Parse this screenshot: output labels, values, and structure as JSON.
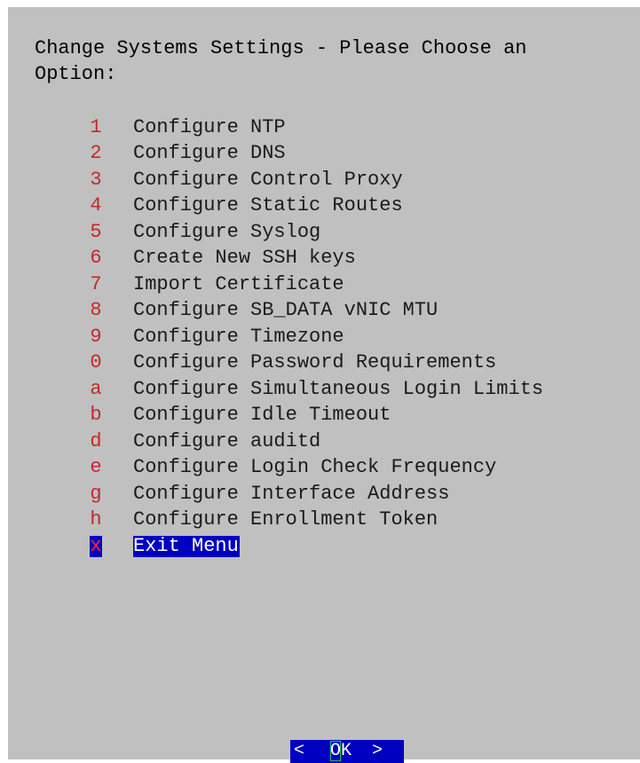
{
  "dialog": {
    "title": "Change Systems Settings - Please Choose an\nOption:"
  },
  "menu": {
    "items": [
      {
        "key": "1",
        "label": "Configure NTP"
      },
      {
        "key": "2",
        "label": "Configure DNS"
      },
      {
        "key": "3",
        "label": "Configure Control Proxy"
      },
      {
        "key": "4",
        "label": "Configure Static Routes"
      },
      {
        "key": "5",
        "label": "Configure Syslog"
      },
      {
        "key": "6",
        "label": "Create New SSH keys"
      },
      {
        "key": "7",
        "label": "Import Certificate"
      },
      {
        "key": "8",
        "label": "Configure SB_DATA vNIC MTU"
      },
      {
        "key": "9",
        "label": "Configure Timezone"
      },
      {
        "key": "0",
        "label": "Configure Password Requirements"
      },
      {
        "key": "a",
        "label": "Configure Simultaneous Login Limits"
      },
      {
        "key": "b",
        "label": "Configure Idle Timeout"
      },
      {
        "key": "d",
        "label": "Configure auditd"
      },
      {
        "key": "e",
        "label": "Configure Login Check Frequency"
      },
      {
        "key": "g",
        "label": "Configure Interface Address"
      },
      {
        "key": "h",
        "label": "Configure Enrollment Token"
      },
      {
        "key": "x",
        "label": "Exit Menu"
      }
    ],
    "selected_key": "x"
  },
  "buttons": {
    "ok": {
      "left_bracket": "<",
      "hotkey": "O",
      "rest": "K",
      "right_bracket": ">"
    }
  },
  "colors": {
    "dialog_background": "#c0c0c0",
    "hotkey": "#c4282a",
    "selection_background": "#0000c0",
    "selection_text": "#ffffff"
  }
}
